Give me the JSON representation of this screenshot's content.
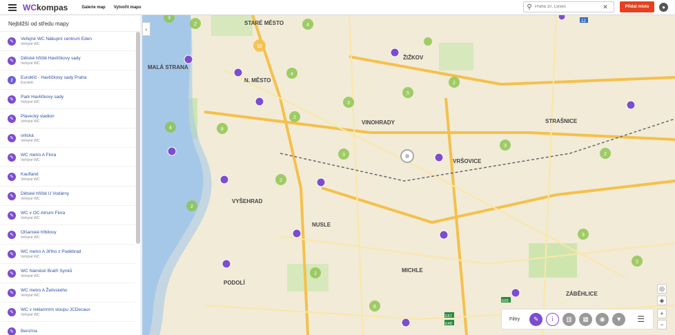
{
  "header": {
    "logo_wc": "WC",
    "logo_rest": "kompas",
    "nav": [
      "Galerie map",
      "Vytvořit mapu"
    ],
    "search_placeholder": "Praha 10, Česko",
    "add_button": "Přidat místo"
  },
  "sidebar": {
    "title": "Nejbližší od středu mapy",
    "items": [
      {
        "name": "Veřejné WC Nákupní centrum Eden",
        "sub": "Veřejné WC"
      },
      {
        "name": "Dětské hřiště Havlíčkovy sady",
        "sub": "Veřejné WC"
      },
      {
        "name": "Euroklíč - Havlíčkovy sady Praha",
        "sub": "Euroklíč"
      },
      {
        "name": "Park Havlíčkovy sady",
        "sub": "Veřejné WC"
      },
      {
        "name": "Plavecký stadion",
        "sub": "Veřejné WC"
      },
      {
        "name": "orlická",
        "sub": "Veřejné WC"
      },
      {
        "name": "WC metro A Flora",
        "sub": "Veřejné WC"
      },
      {
        "name": "Kaufland",
        "sub": "Veřejné WC"
      },
      {
        "name": "Dětské hřiště U Vodárny",
        "sub": "Veřejné WC"
      },
      {
        "name": "WC v OC Atrium Flora",
        "sub": "Veřejné WC"
      },
      {
        "name": "Olšanské hřbitovy",
        "sub": "Veřejné WC"
      },
      {
        "name": "WC metro A Jiřího z Poděbrad",
        "sub": "Veřejné WC"
      },
      {
        "name": "WC Náměstí Bratří Synků",
        "sub": "Veřejné WC"
      },
      {
        "name": "WC metro A Želivského",
        "sub": "Veřejné WC"
      },
      {
        "name": "WC v reklamním sloupu JCDecaux",
        "sub": "Veřejné WC"
      },
      {
        "name": "Benzína",
        "sub": ""
      }
    ]
  },
  "map": {
    "labels": [
      "STARÉ MĚSTO",
      "ŽIŽKOV",
      "MALÁ STRANA",
      "N. MĚSTO",
      "VINOHRADY",
      "STRAŠNICE",
      "VRŠOVICE",
      "VYŠEHRAD",
      "NUSLE",
      "MICHLE",
      "PODOLÍ",
      "ZÁBĚHLICE"
    ],
    "clusters": [
      "3",
      "2",
      "4",
      "10",
      "4",
      "5",
      "2",
      "3",
      "2",
      "4",
      "8",
      "2",
      "3",
      "3",
      "2",
      "2",
      "3",
      "2",
      "8",
      "2",
      "8"
    ],
    "route_labels": [
      "12",
      "E65",
      "E67",
      "E48"
    ]
  },
  "filters": {
    "label": "Filtry"
  },
  "colors": {
    "accent": "#7c4dce",
    "add_button": "#e8401c",
    "cluster": "#8bc34a"
  }
}
